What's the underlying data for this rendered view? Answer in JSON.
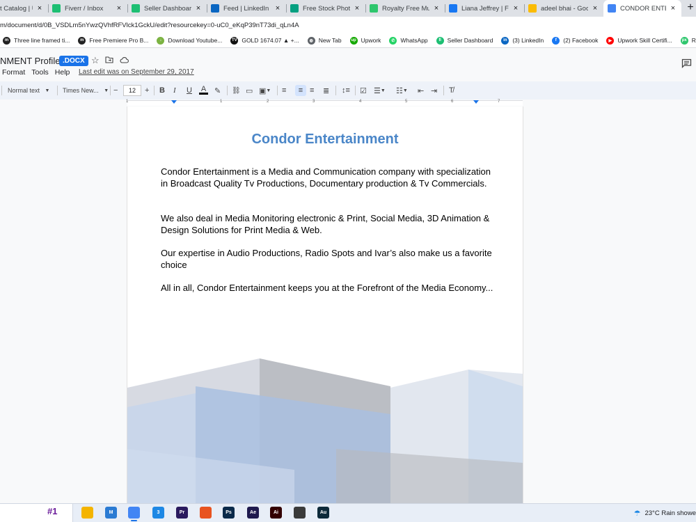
{
  "browser": {
    "tabs": [
      {
        "title": "t Catalog | U",
        "icon": "upwork",
        "color": "#14a800"
      },
      {
        "title": "Fiverr / Inbox",
        "icon": "fiverr",
        "color": "#1dbf73"
      },
      {
        "title": "Seller Dashboard",
        "icon": "fiverr",
        "color": "#1dbf73"
      },
      {
        "title": "Feed | LinkedIn",
        "icon": "linkedin",
        "color": "#0a66c2"
      },
      {
        "title": "Free Stock Photo &",
        "icon": "pexels",
        "color": "#05a081"
      },
      {
        "title": "Royalty Free Music",
        "icon": "pixabay",
        "color": "#2ec66d"
      },
      {
        "title": "Liana Jeffrey | Face",
        "icon": "facebook",
        "color": "#1877f2"
      },
      {
        "title": "adeel bhai - Googl",
        "icon": "google-drive",
        "color": "#fbbc04"
      },
      {
        "title": "CONDOR ENTERTAI",
        "icon": "google-docs",
        "color": "#4285f4",
        "active": true
      }
    ],
    "new_tab": "+",
    "close_glyph": "×",
    "address": "m/document/d/0B_VSDLm5nYwzQVhfRFVlck1GckU/edit?resourcekey=0-uC0_eKqP39nT73di_qLn4A",
    "bookmarks": [
      {
        "label": "Three line framed ti...",
        "color": "#222",
        "glyph": "m"
      },
      {
        "label": "Free Premiere Pro B...",
        "color": "#222",
        "glyph": "m"
      },
      {
        "label": "Download Youtube...",
        "color": "#7cb342",
        "glyph": "↓"
      },
      {
        "label": "GOLD 1674.07 ▲ +...",
        "color": "#111",
        "glyph": "TV"
      },
      {
        "label": "New Tab",
        "color": "#5f6368",
        "glyph": "◍"
      },
      {
        "label": "Upwork",
        "color": "#14a800",
        "glyph": "up"
      },
      {
        "label": "WhatsApp",
        "color": "#25d366",
        "glyph": "✆"
      },
      {
        "label": "Seller Dashboard",
        "color": "#1dbf73",
        "glyph": "fi"
      },
      {
        "label": "(3) LinkedIn",
        "color": "#0a66c2",
        "glyph": "in"
      },
      {
        "label": "(2) Facebook",
        "color": "#1877f2",
        "glyph": "f"
      },
      {
        "label": "Upwork Skill Certifi...",
        "color": "#ff0000",
        "glyph": "▶"
      },
      {
        "label": "Royalty Fr",
        "color": "#2ec66d",
        "glyph": "px"
      }
    ]
  },
  "docs": {
    "doc_name": "NMENT Profile",
    "doc_badge": ".DOCX",
    "menus": [
      "Format",
      "Tools",
      "Help"
    ],
    "last_edit": "Last edit was on September 29, 2017",
    "toolbar": {
      "style": "Normal text",
      "font": "Times New...",
      "font_size": "12"
    },
    "ruler_numbers": [
      "1",
      "1",
      "2",
      "3",
      "4",
      "5",
      "6",
      "7"
    ]
  },
  "document": {
    "title": "Condor Entertainment",
    "paragraphs": [
      "Condor Entertainment is a Media and Communication company with specialization in Broadcast Quality Tv Productions, Documentary production & Tv Commercials.",
      "We also deal in Media Monitoring electronic & Print, Social Media, 3D Animation & Design Solutions for Print Media & Web.",
      "Our expertise in Audio Productions, Radio Spots and Ivar’s also make us a favorite choice",
      "All in all, Condor Entertainment keeps you at the Forefront of the Media Economy..."
    ]
  },
  "taskbar": {
    "widget": "#1",
    "apps": [
      {
        "name": "file-explorer",
        "label": "",
        "color": "#f4b400"
      },
      {
        "name": "mail",
        "label": "M",
        "color": "#2b7bd3"
      },
      {
        "name": "chrome",
        "label": "",
        "color": "#4285f4",
        "active": true
      },
      {
        "name": "calendar",
        "label": "3",
        "color": "#1e88e5"
      },
      {
        "name": "premiere",
        "label": "Pr",
        "color": "#2a1a5e"
      },
      {
        "name": "office",
        "label": "",
        "color": "#e8531f"
      },
      {
        "name": "photoshop",
        "label": "Ps",
        "color": "#0b2a4a"
      },
      {
        "name": "after-effects",
        "label": "Ae",
        "color": "#1f1a4e"
      },
      {
        "name": "illustrator",
        "label": "Ai",
        "color": "#330000"
      },
      {
        "name": "davinci",
        "label": "",
        "color": "#3a3a3a"
      },
      {
        "name": "audition",
        "label": "Au",
        "color": "#0d2a3a"
      }
    ],
    "weather": "23°C  Rain showe"
  }
}
